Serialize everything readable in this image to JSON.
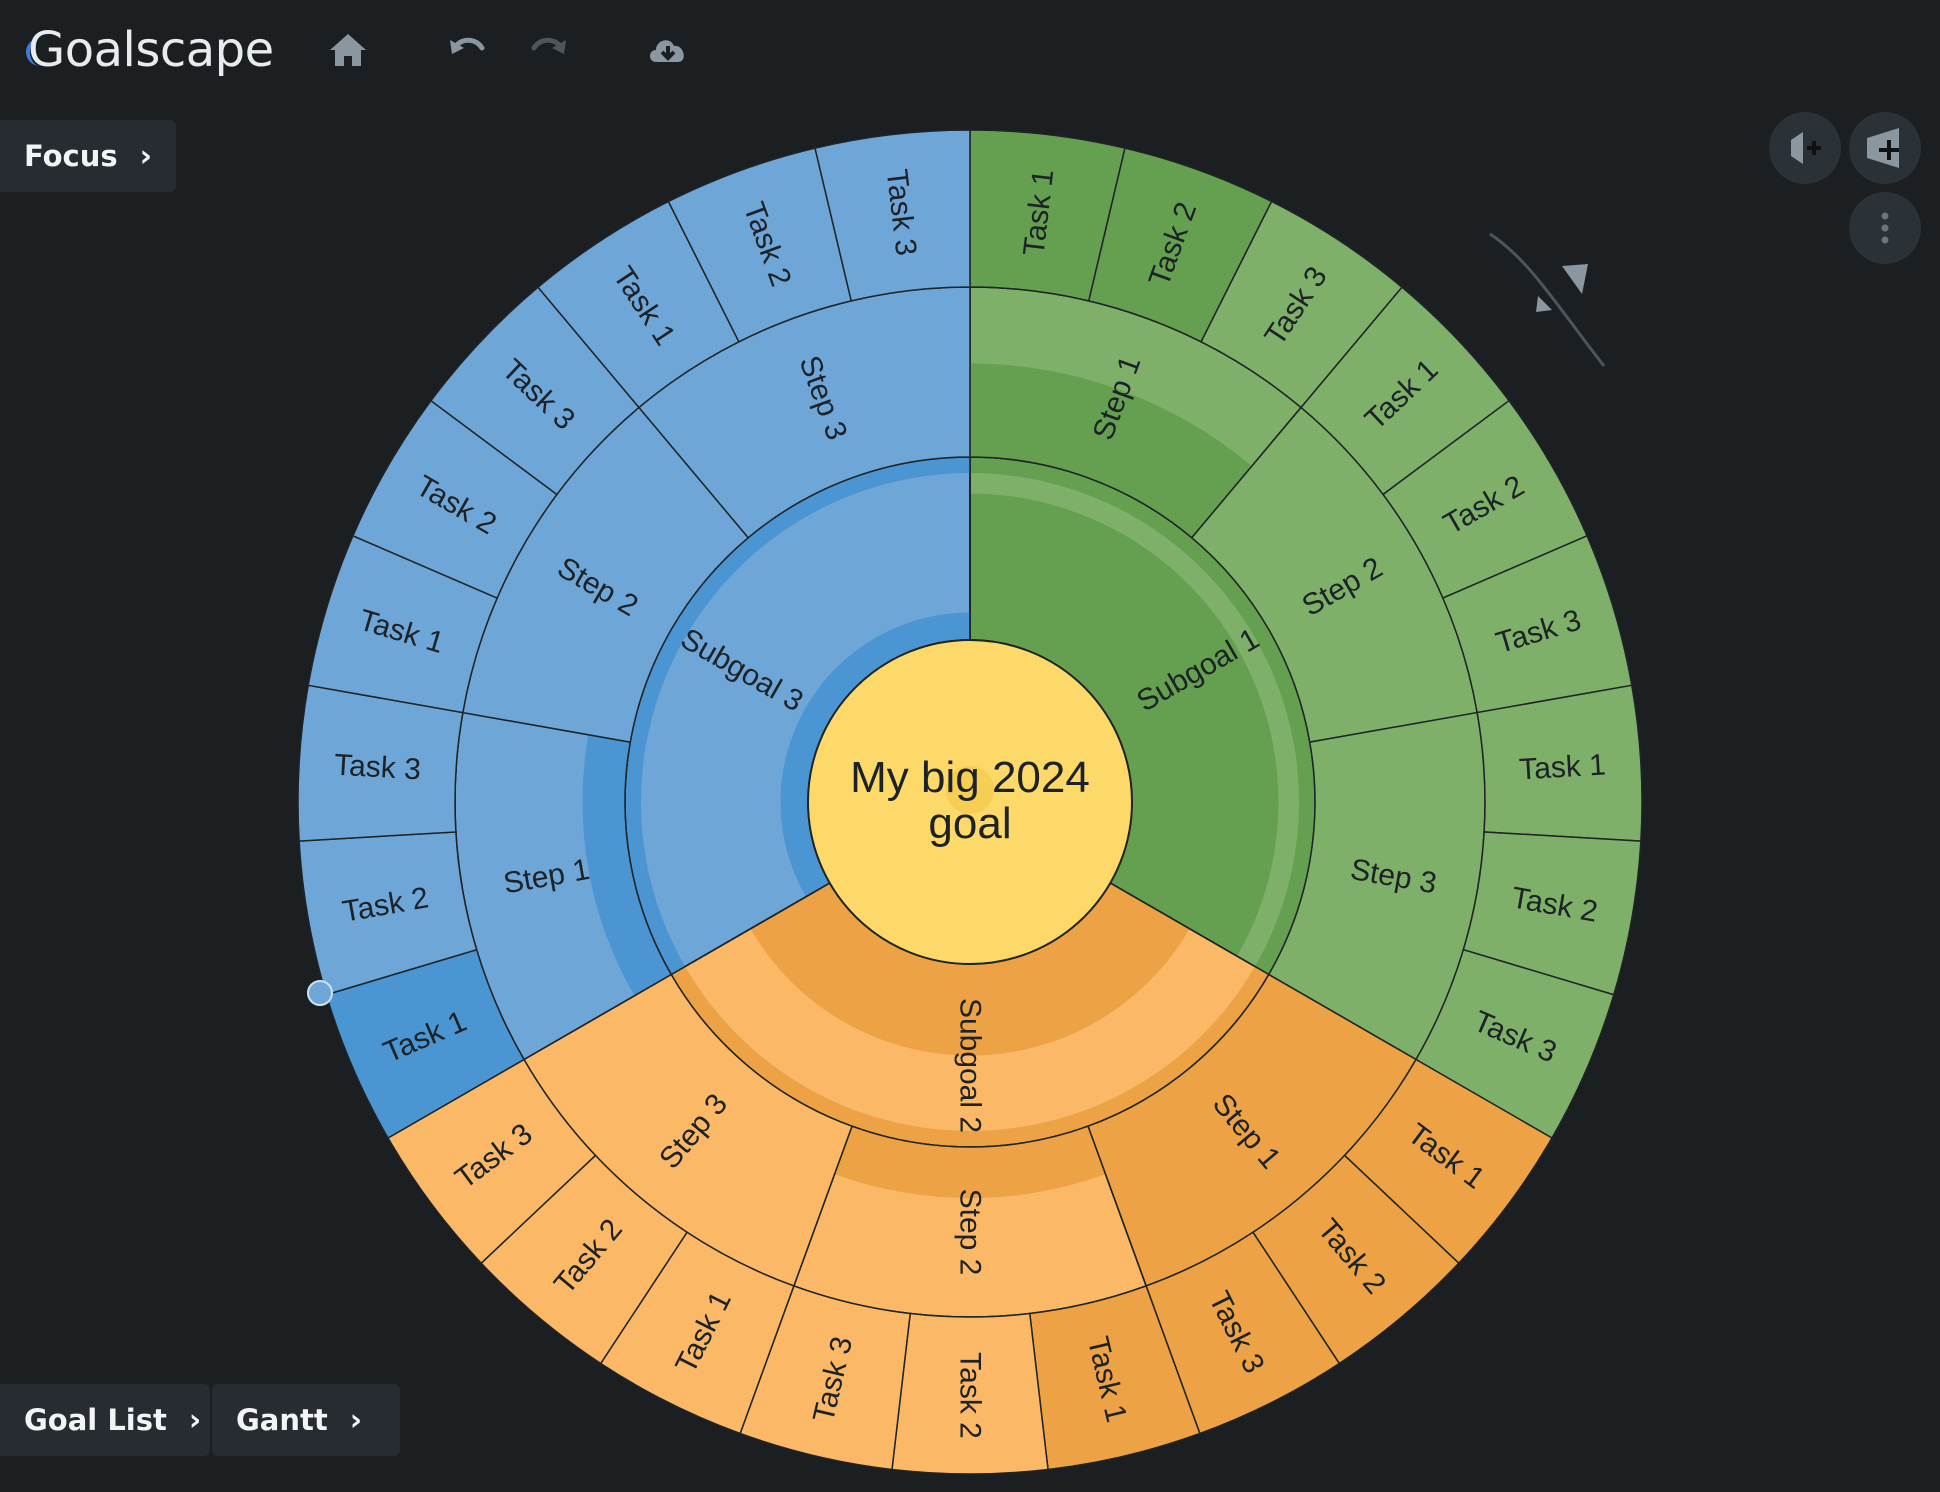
{
  "app": {
    "title": "Goalscape"
  },
  "toolbar": {
    "home_icon": "home-icon",
    "undo_icon": "undo-icon",
    "redo_icon": "redo-icon",
    "cloud_icon": "cloud-download-icon"
  },
  "panels": {
    "focus_label": "Focus",
    "goal_list_label": "Goal List",
    "gantt_label": "Gantt"
  },
  "colors": {
    "background": "#1b1f22",
    "blue": "#6fa6d8",
    "blue_dark": "#4a95d2",
    "green": "#7eb06a",
    "green_dark": "#64a050",
    "orange": "#fbb867",
    "orange_dark": "#eca245",
    "center": "#fdd96a"
  },
  "center_goal": {
    "label": "My big 2024 goal"
  },
  "subgoals": [
    {
      "name": "Subgoal 1",
      "color": "green",
      "progress": 0.8,
      "steps": [
        {
          "name": "Step 1",
          "progress": 0.55,
          "tasks": [
            "Task 1",
            "Task 2",
            "Task 3"
          ],
          "task_done": [
            true,
            true,
            false
          ]
        },
        {
          "name": "Step 2",
          "progress": 0,
          "tasks": [
            "Task 1",
            "Task 2",
            "Task 3"
          ],
          "task_done": [
            false,
            false,
            false
          ]
        },
        {
          "name": "Step 3",
          "progress": 0,
          "tasks": [
            "Task 1",
            "Task 2",
            "Task 3"
          ],
          "task_done": [
            false,
            false,
            false
          ]
        }
      ]
    },
    {
      "name": "Subgoal 2",
      "color": "orange",
      "progress": 0.5,
      "steps": [
        {
          "name": "Step 1",
          "progress": 1,
          "tasks": [
            "Task 1",
            "Task 2",
            "Task 3"
          ],
          "task_done": [
            true,
            true,
            true
          ]
        },
        {
          "name": "Step 2",
          "progress": 0.3,
          "tasks": [
            "Task 1",
            "Task 2",
            "Task 3"
          ],
          "task_done": [
            true,
            false,
            false
          ]
        },
        {
          "name": "Step 3",
          "progress": 0,
          "tasks": [
            "Task 1",
            "Task 2",
            "Task 3"
          ],
          "task_done": [
            false,
            false,
            false
          ]
        }
      ]
    },
    {
      "name": "Subgoal 3",
      "color": "blue",
      "progress": 0.15,
      "steps": [
        {
          "name": "Step 1",
          "progress": 0.25,
          "tasks": [
            "Task 1",
            "Task 2",
            "Task 3"
          ],
          "task_done": [
            true,
            false,
            false
          ]
        },
        {
          "name": "Step 2",
          "progress": 0,
          "tasks": [
            "Task 1",
            "Task 2",
            "Task 3"
          ],
          "task_done": [
            false,
            false,
            false
          ]
        },
        {
          "name": "Step 3",
          "progress": 0,
          "tasks": [
            "Task 1",
            "Task 2",
            "Task 3"
          ],
          "task_done": [
            false,
            false,
            false
          ]
        }
      ]
    }
  ],
  "right_controls": {
    "zoom_out_icon": "zoom-out-icon",
    "zoom_in_icon": "zoom-in-icon",
    "more_icon": "more-vertical-icon",
    "rotate_icon": "rotate-arc-icon"
  }
}
